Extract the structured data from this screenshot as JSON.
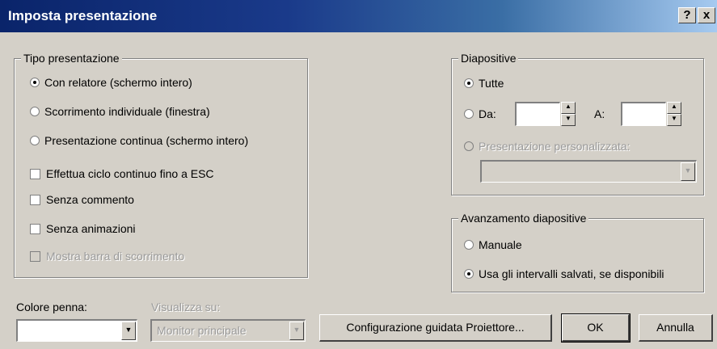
{
  "window": {
    "title": "Imposta presentazione",
    "help_label": "?",
    "close_label": "x"
  },
  "tipo": {
    "legend": "Tipo presentazione",
    "radios": [
      {
        "label": "Con relatore (schermo intero)",
        "selected": true
      },
      {
        "label": "Scorrimento individuale (finestra)",
        "selected": false
      },
      {
        "label": "Presentazione continua (schermo intero)",
        "selected": false
      }
    ],
    "checks": [
      {
        "label": "Effettua ciclo continuo fino a ESC"
      },
      {
        "label": "Senza commento"
      },
      {
        "label": "Senza animazioni"
      },
      {
        "label": "Mostra barra di scorrimento",
        "disabled": true
      }
    ]
  },
  "diapositive": {
    "legend": "Diapositive",
    "tutte": "Tutte",
    "da": "Da:",
    "a": "A:",
    "personalizzata": "Presentazione personalizzata:"
  },
  "avanzamento": {
    "legend": "Avanzamento diapositive",
    "manuale": "Manuale",
    "intervalli": "Usa gli intervalli salvati, se disponibili"
  },
  "bottom": {
    "colore_label": "Colore penna:",
    "visualizza_label": "Visualizza su:",
    "visualizza_value": "Monitor principale",
    "config_button": "Configurazione guidata Proiettore...",
    "ok_button": "OK",
    "cancel_button": "Annulla"
  }
}
